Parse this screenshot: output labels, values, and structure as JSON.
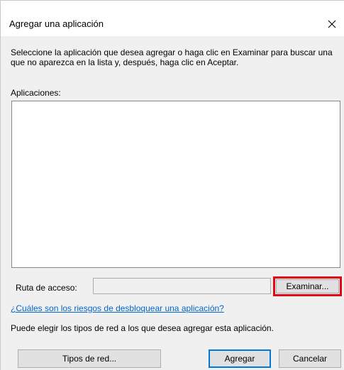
{
  "dialog": {
    "title": "Agregar una aplicación",
    "close_icon": "close-icon",
    "instruction": "Seleccione la aplicación que desea agregar o haga clic en Examinar para buscar una que no aparezca en la lista y, después, haga clic en Aceptar.",
    "apps_label": "Aplicaciones:",
    "applications": [],
    "path": {
      "label": "Ruta de acceso:",
      "value": ""
    },
    "browse_label": "Examinar...",
    "highlight_color": "#e30613",
    "risk_link": "¿Cuáles son los riesgos de desbloquear una aplicación?",
    "network_note": "Puede elegir los tipos de red a los que desea agregar esta aplicación.",
    "buttons": {
      "network_types": "Tipos de red...",
      "add": "Agregar",
      "cancel": "Cancelar"
    }
  }
}
